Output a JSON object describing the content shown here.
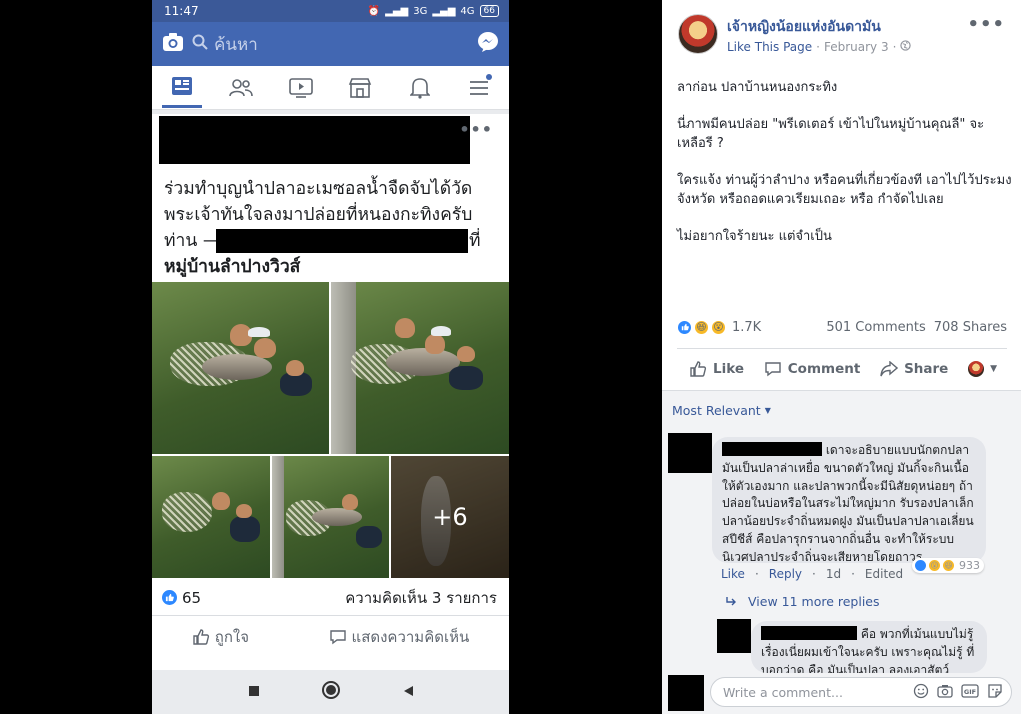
{
  "phone": {
    "status": {
      "time": "11:47",
      "network": "3G",
      "network2": "4G",
      "battery": "66"
    },
    "search": {
      "placeholder": "ค้นหา"
    },
    "tabs": [
      "news-feed",
      "friends",
      "watch",
      "marketplace",
      "notifications",
      "menu"
    ],
    "post": {
      "text_line1": "ร่วมทำบุญนำปลาอะเมซอลน้ำจืดจับได้วัด",
      "text_line2": "พระเจ้าทันใจลงมาปล่อยที่หนองกะทิงครับ",
      "text_line3_start": "ท่าน —",
      "text_line3_end": "ที่",
      "text_line4": "หมู่บ้านลำปางวิวส์",
      "more_photos": "+6",
      "like_count": "65",
      "comment_count": "ความคิดเห็น 3 รายการ",
      "like_label": "ถูกใจ",
      "comment_label": "แสดงความคิดเห็น"
    }
  },
  "panel": {
    "page_name": "เจ้าหญิงน้อยแห่งอันดามัน",
    "like_page": "Like This Page",
    "date": "February 3",
    "paragraphs": [
      "ลาก่อน ปลาบ้านหนองกระทิง",
      "นี่ภาพมีคนปล่อย \"พรีเดเตอร์ เข้าไปในหมู่บ้านคุณลี\" จะเหลือรี ?",
      "ใครแจ้ง ท่านผู้ว่าลำปาง หรือคนที่เกี่ยวข้องที เอาไปไว้ประมงจังหวัด หรือถอดแควเรียมเถอะ หรือ กำจัดไปเลย",
      "ไม่อยากใจร้ายนะ แต่จำเป็น"
    ],
    "reactions": "1.7K",
    "comments": "501 Comments",
    "shares": "708 Shares",
    "actions": {
      "like": "Like",
      "comment": "Comment",
      "share": "Share"
    },
    "sort": "Most Relevant",
    "comment1": {
      "text": "เดาจะอธิบายแบบนักตกปลา มันเป็นปลาล่าเหยื่อ ขนาดตัวใหญ่ มันกิ้จะกินเนื้อให้ตัวเองมาก และปลาพวกนี้จะมีนิสัยดุหน่อยๆ ถ้าปล่อยในบ่อหรือในสระไม่ใหญ่มาก รับรองปลาเล็กปลาน้อยประจำถิ่นหมดฝูง มันเป็นปลาปลาเอเลี่ยน สปีชีส์ คือปลารุกรานจากถิ่นอื่น จะทำให้ระบบนิเวศปลาประจำถิ่นจะเสียหายโดยถาวร",
      "like": "Like",
      "reply": "Reply",
      "time": "1d",
      "edited": "Edited",
      "reactions": "933"
    },
    "view_replies": "View 11 more replies",
    "reply1": {
      "text": "คือ พวกที่เม้นแบบไม่รู้เรื่องเนี่ยผมเข้าใจนะครับ เพราะคุณไม่รู้ ที่บอกว่าด คือ มันเป็นปลา ลองเอาสัตว์"
    },
    "write_placeholder": "Write a comment..."
  }
}
